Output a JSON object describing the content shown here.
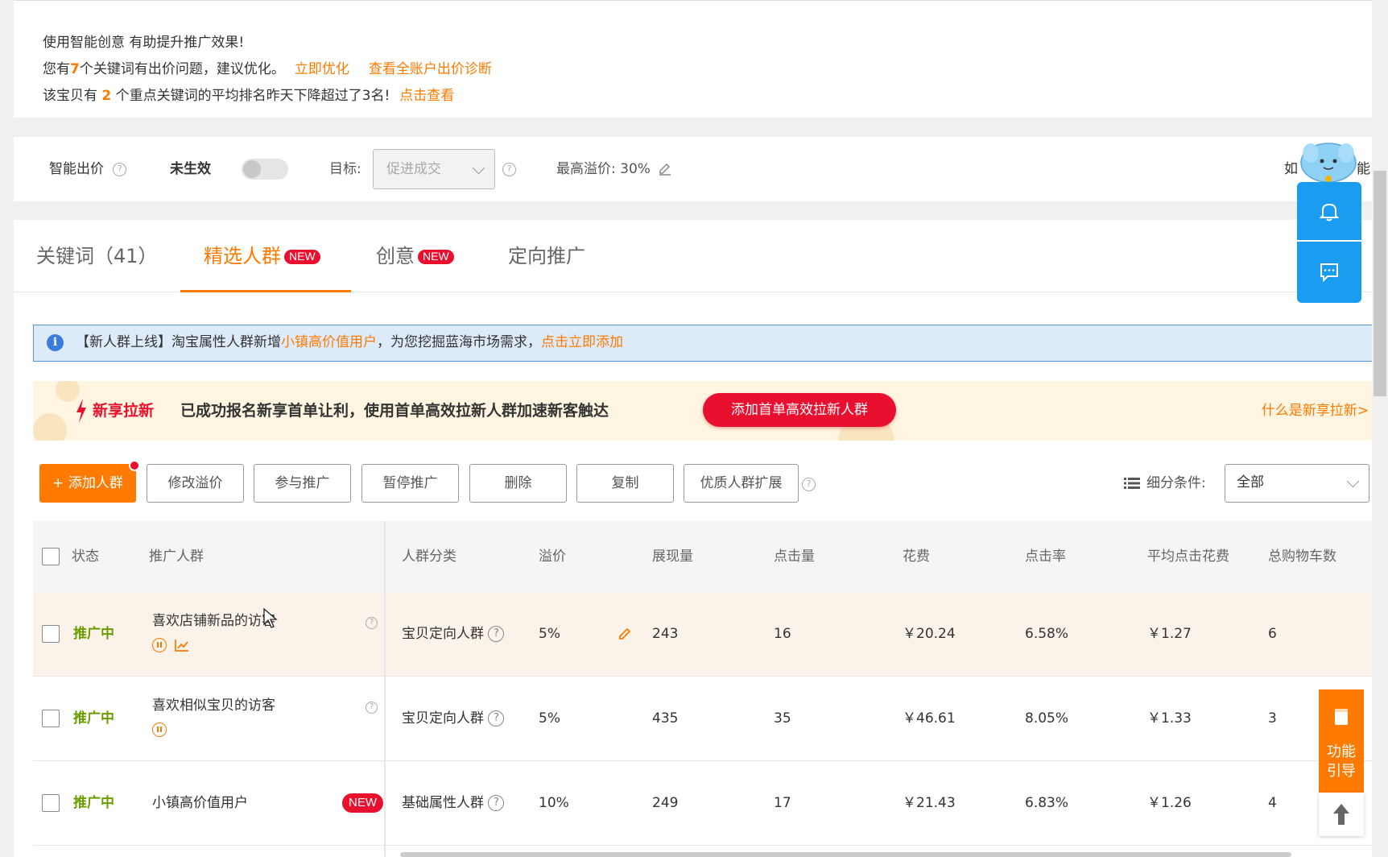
{
  "notice": {
    "line1": "使用智能创意  有助提升推广效果!",
    "line2_prefix": "您有",
    "line2_count": "7",
    "line2_suffix": "个关键词有出价问题，建议优化。",
    "line2_link1": "立即优化",
    "line2_link2": "查看全账户出价诊断",
    "line3_prefix": "该宝贝有 ",
    "line3_count": "2",
    "line3_suffix": " 个重点关键词的平均排名昨天下降超过了3名!",
    "line3_link": "点击查看"
  },
  "smart_bid": {
    "label": "智能出价",
    "status": "未生效",
    "target_label": "目标:",
    "target_value": "促进成交",
    "max_premium": "最高溢价: 30%",
    "right_text_a": "如",
    "right_text_b": "能"
  },
  "tabs": [
    {
      "label": "关键词（41）",
      "active": false,
      "badge": ""
    },
    {
      "label": "精选人群",
      "active": true,
      "badge": "NEW"
    },
    {
      "label": "创意",
      "active": false,
      "badge": "NEW"
    },
    {
      "label": "定向推广",
      "active": false,
      "badge": ""
    }
  ],
  "info_banner": {
    "prefix": "【新人群上线】淘宝属性人群新增",
    "highlight": "小镇高价值用户",
    "middle": "，为您挖掘蓝海市场需求，",
    "link": "点击立即添加"
  },
  "promo": {
    "title": "新享拉新",
    "text": "已成功报名新享首单让利，使用首单高效拉新人群加速新客触达",
    "button": "添加首单高效拉新人群",
    "link": "什么是新享拉新>"
  },
  "toolbar": {
    "add": "+ 添加人群",
    "modify": "修改溢价",
    "join": "参与推广",
    "pause": "暂停推广",
    "delete": "删除",
    "copy": "复制",
    "expand": "优质人群扩展",
    "filter_label": "细分条件:",
    "filter_value": "全部"
  },
  "table": {
    "headers": {
      "status": "状态",
      "crowd": "推广人群",
      "category": "人群分类",
      "premium": "溢价",
      "impressions": "展现量",
      "clicks": "点击量",
      "cost": "花费",
      "ctr": "点击率",
      "cpc": "平均点击花费",
      "carts": "总购物车数"
    },
    "rows": [
      {
        "status": "推广中",
        "name": "喜欢店铺新品的访客",
        "category": "宝贝定向人群",
        "premium": "5%",
        "impressions": "243",
        "clicks": "16",
        "cost": "￥20.24",
        "ctr": "6.58%",
        "cpc": "￥1.27",
        "carts": "6"
      },
      {
        "status": "推广中",
        "name": "喜欢相似宝贝的访客",
        "category": "宝贝定向人群",
        "premium": "5%",
        "impressions": "435",
        "clicks": "35",
        "cost": "￥46.61",
        "ctr": "8.05%",
        "cpc": "￥1.33",
        "carts": "3"
      },
      {
        "status": "推广中",
        "name": "小镇高价值用户",
        "badge": "NEW",
        "category": "基础属性人群",
        "premium": "10%",
        "impressions": "249",
        "clicks": "17",
        "cost": "￥21.43",
        "ctr": "6.83%",
        "cpc": "￥1.26",
        "carts": "4"
      }
    ]
  },
  "side": {
    "guide_line1": "功能",
    "guide_line2": "引导"
  },
  "colors": {
    "accent": "#ff7a00",
    "status_green": "#6a9e00",
    "badge_red": "#e8102e",
    "float_blue": "#1a9cf0"
  }
}
